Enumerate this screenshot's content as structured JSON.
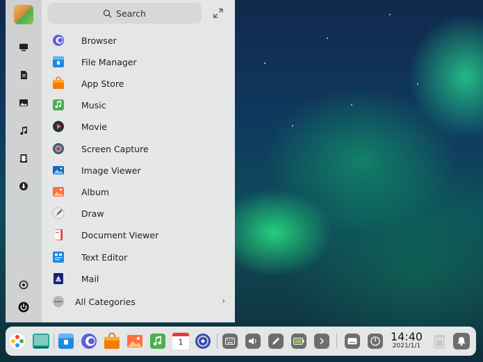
{
  "launcher": {
    "search": {
      "placeholder": "Search"
    },
    "categories": [
      {
        "icon": "monitor-icon"
      },
      {
        "icon": "document-icon"
      },
      {
        "icon": "image-icon"
      },
      {
        "icon": "music-note-icon"
      },
      {
        "icon": "film-icon"
      },
      {
        "icon": "download-icon"
      },
      {
        "icon": "settings-icon"
      },
      {
        "icon": "power-icon"
      }
    ],
    "apps": [
      {
        "label": "Browser",
        "icon": "browser-icon"
      },
      {
        "label": "File Manager",
        "icon": "file-manager-icon"
      },
      {
        "label": "App Store",
        "icon": "app-store-icon"
      },
      {
        "label": "Music",
        "icon": "music-icon"
      },
      {
        "label": "Movie",
        "icon": "movie-icon"
      },
      {
        "label": "Screen Capture",
        "icon": "screen-capture-icon"
      },
      {
        "label": "Image Viewer",
        "icon": "image-viewer-icon"
      },
      {
        "label": "Album",
        "icon": "album-icon"
      },
      {
        "label": "Draw",
        "icon": "draw-icon"
      },
      {
        "label": "Document Viewer",
        "icon": "document-viewer-icon"
      },
      {
        "label": "Text Editor",
        "icon": "text-editor-icon"
      },
      {
        "label": "Mail",
        "icon": "mail-icon"
      }
    ],
    "all_categories": "All Categories"
  },
  "dock": {
    "apps": [
      {
        "icon": "launcher-icon"
      },
      {
        "icon": "multitasking-view-icon"
      },
      {
        "icon": "file-manager-icon"
      },
      {
        "icon": "browser-icon"
      },
      {
        "icon": "app-store-icon"
      },
      {
        "icon": "album-icon"
      },
      {
        "icon": "music-icon"
      },
      {
        "icon": "calendar-icon",
        "day": "1"
      },
      {
        "icon": "control-center-icon"
      }
    ],
    "tray": [
      {
        "icon": "keyboard-icon"
      },
      {
        "icon": "volume-icon"
      },
      {
        "icon": "pen-icon"
      },
      {
        "icon": "battery-icon"
      },
      {
        "icon": "expand-tray-icon"
      },
      {
        "icon": "onscreen-keyboard-icon"
      },
      {
        "icon": "shutdown-icon"
      }
    ],
    "clock": {
      "time": "14:40",
      "date": "2021/1/1"
    },
    "trash": {
      "icon": "trash-icon"
    },
    "notifications": {
      "icon": "notification-bell-icon"
    }
  },
  "colors": {
    "accent_blue": "#1e88e5",
    "tray_gray": "#6d6d6d",
    "aurora_green": "#28e682"
  }
}
